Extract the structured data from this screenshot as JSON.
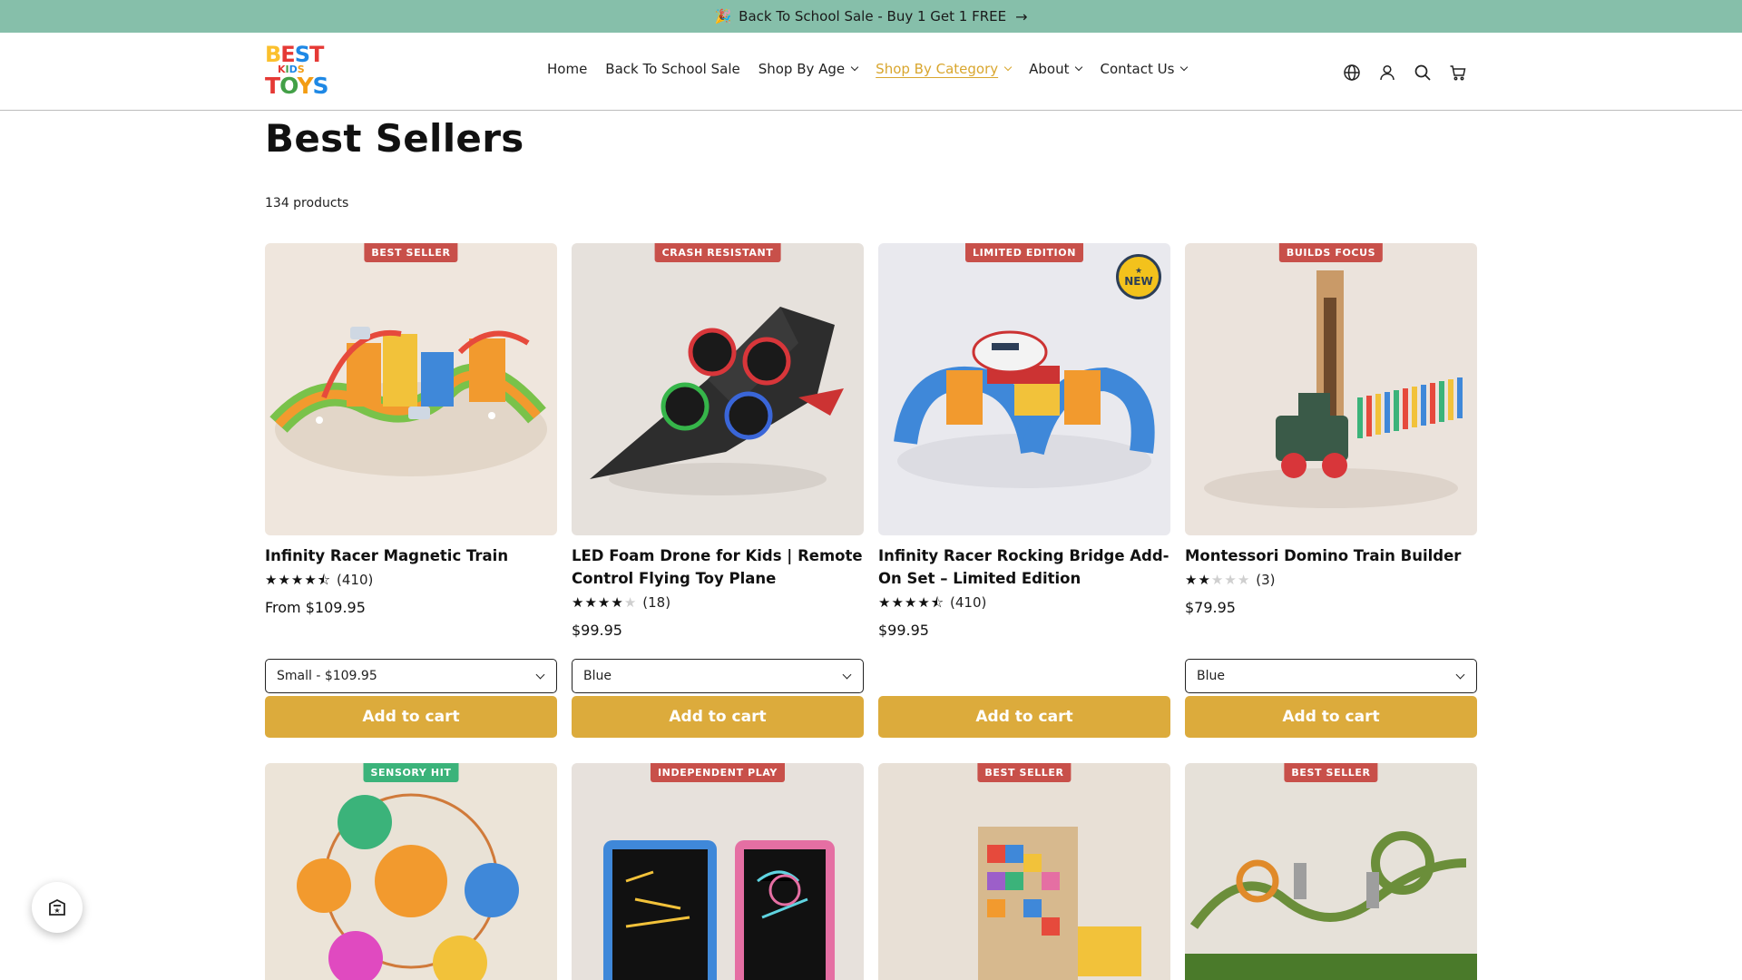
{
  "announcement": {
    "text": "Back To School Sale - Buy 1 Get 1 FREE",
    "icon": "party-popper-icon"
  },
  "header": {
    "logo": {
      "line1": "BEST",
      "line2": "KIDS",
      "line3": "TOYS"
    },
    "nav": [
      {
        "label": "Home",
        "dropdown": false
      },
      {
        "label": "Back To School Sale",
        "dropdown": false
      },
      {
        "label": "Shop By Age",
        "dropdown": true
      },
      {
        "label": "Shop By Category",
        "dropdown": true,
        "active": true
      },
      {
        "label": "About",
        "dropdown": true
      },
      {
        "label": "Contact Us",
        "dropdown": true
      }
    ],
    "icons": [
      "globe-icon",
      "account-icon",
      "search-icon",
      "cart-icon"
    ]
  },
  "page": {
    "title": "Best Sellers",
    "count": "134 products"
  },
  "colors": {
    "accent": "#dcab3c",
    "announce_bg": "#86bfaa",
    "badge_red": "#c8504a",
    "badge_green": "#3bb37a",
    "nav_active": "#d9a62e"
  },
  "products": [
    {
      "badge": "BEST SELLER",
      "badge_color": "#c8504a",
      "title": "Infinity Racer Magnetic Train",
      "rating": 4.5,
      "reviews": "(410)",
      "price": "From $109.95",
      "variant": "Small - $109.95",
      "cta": "Add to cart"
    },
    {
      "badge": "CRASH RESISTANT",
      "badge_color": "#c8504a",
      "title": "LED Foam Drone for Kids | Remote Control Flying Toy Plane",
      "rating": 4,
      "reviews": "(18)",
      "price": "$99.95",
      "variant": "Blue",
      "cta": "Add to cart"
    },
    {
      "badge": "LIMITED EDITION",
      "badge_color": "#c8504a",
      "title": "Infinity Racer Rocking Bridge Add-On Set – Limited Edition",
      "rating": 4.5,
      "reviews": "(410)",
      "price": "$99.95",
      "variant": "",
      "cta": "Add to cart",
      "seal": "NEW"
    },
    {
      "badge": "BUILDS FOCUS",
      "badge_color": "#c8504a",
      "title": "Montessori Domino Train Builder",
      "rating": 2,
      "reviews": "(3)",
      "price": "$79.95",
      "variant": "Blue",
      "cta": "Add to cart"
    },
    {
      "badge": "SENSORY HIT",
      "badge_color": "#3bb37a"
    },
    {
      "badge": "INDEPENDENT PLAY",
      "badge_color": "#c8504a"
    },
    {
      "badge": "BEST SELLER",
      "badge_color": "#c8504a"
    },
    {
      "badge": "BEST SELLER",
      "badge_color": "#c8504a"
    }
  ]
}
